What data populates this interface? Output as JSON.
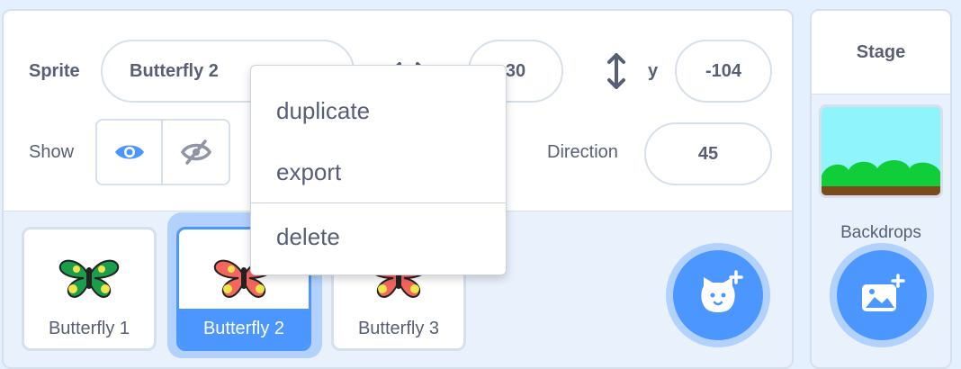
{
  "sprite_info": {
    "sprite_label": "Sprite",
    "sprite_name": "Butterfly 2",
    "x_value": "30",
    "y_label": "y",
    "y_value": "-104",
    "show_label": "Show",
    "direction_label": "Direction",
    "direction_value": "45"
  },
  "sprites": [
    {
      "name": "Butterfly 1",
      "selected": false,
      "colors": {
        "wing": "#1b9e4b",
        "spot": "#f2e54a"
      }
    },
    {
      "name": "Butterfly 2",
      "selected": true,
      "colors": {
        "wing": "#f2665e",
        "spot": "#f2e54a"
      }
    },
    {
      "name": "Butterfly 3",
      "selected": false,
      "colors": {
        "wing": "#f2665e",
        "spot": "#f2e54a"
      }
    }
  ],
  "context_menu": {
    "items": [
      {
        "label": "duplicate"
      },
      {
        "label": "export"
      },
      {
        "label": "delete"
      }
    ]
  },
  "stage": {
    "title": "Stage",
    "backdrops_label": "Backdrops"
  },
  "icons": {
    "add_sprite": "cat-plus-icon",
    "add_backdrop": "image-plus-icon",
    "show": "eye-icon",
    "hide": "eye-slash-icon",
    "y_axis": "up-down-arrow-icon",
    "x_axis": "left-right-arrow-icon"
  },
  "colors": {
    "accent": "#4c97ff",
    "text": "#575e75",
    "border": "#d6dfec"
  }
}
